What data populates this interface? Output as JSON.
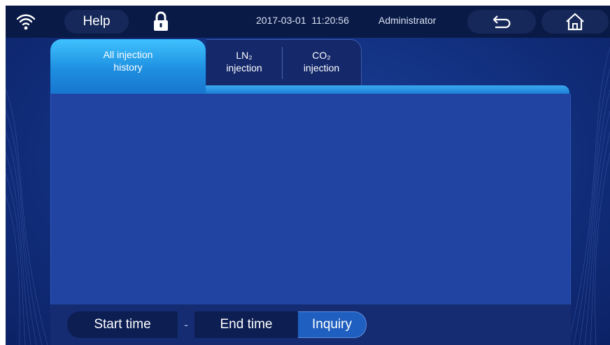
{
  "topbar": {
    "help_label": "Help",
    "datetime": "2017-03-01  11:20:56",
    "user": "Administrator"
  },
  "tabs": {
    "all_line1": "All injection",
    "all_line2": "history",
    "ln2_line1": "LN₂",
    "ln2_line2": "injection",
    "co2_line1": "CO₂",
    "co2_line2": "injection"
  },
  "query": {
    "start_label": "Start time",
    "separator": "-",
    "end_label": "End time",
    "inquiry_label": "Inquiry"
  },
  "colors": {
    "active_tab": "#1e8fe0",
    "panel": "#2144a3",
    "topbar": "#0a1a47"
  }
}
